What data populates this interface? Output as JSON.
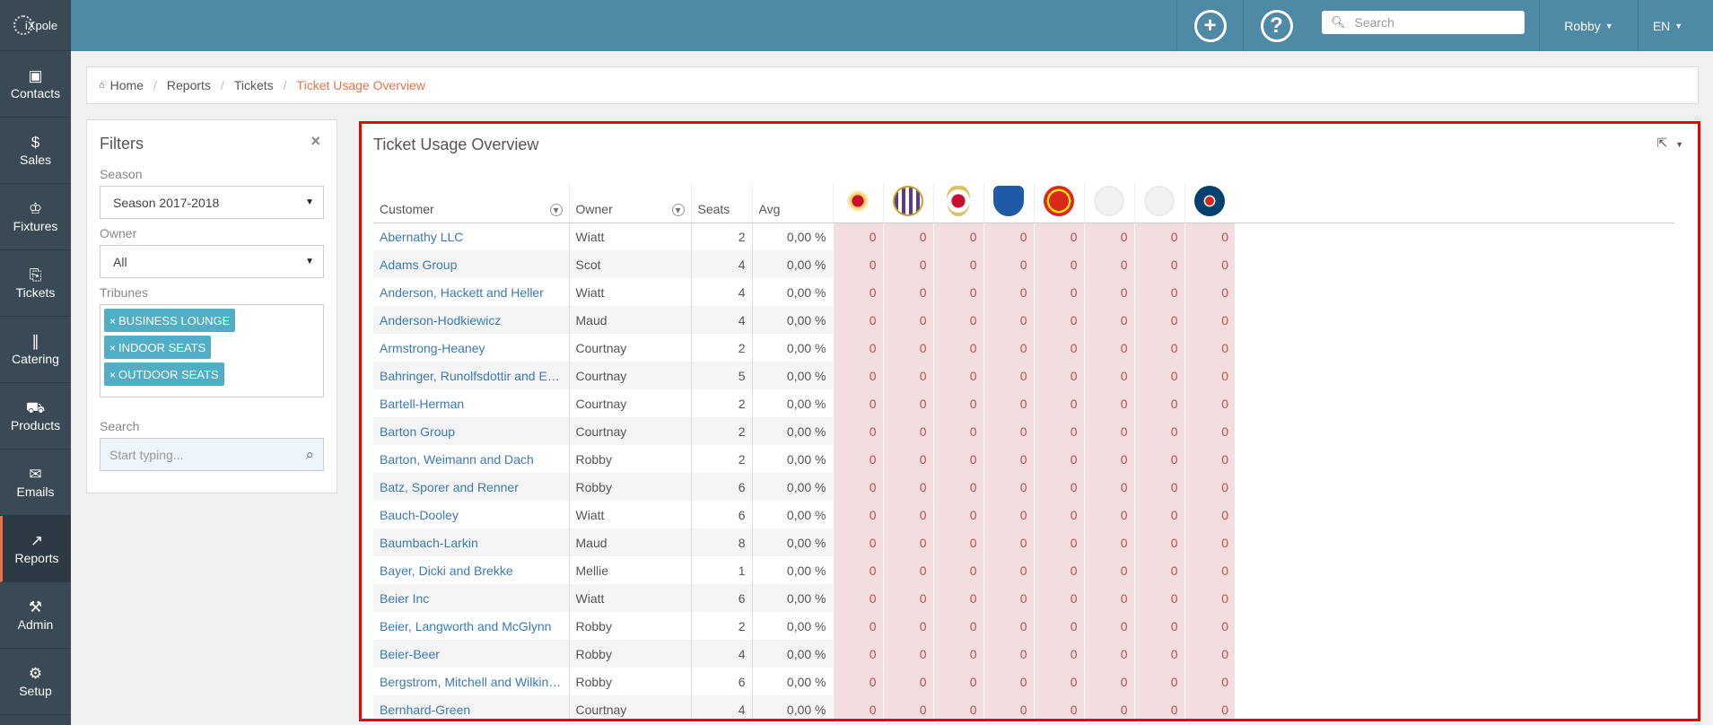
{
  "sidebar": {
    "logo": "iXpole",
    "items": [
      {
        "label": "Contacts",
        "icon": "contact-card-icon"
      },
      {
        "label": "Sales",
        "icon": "dollar-icon"
      },
      {
        "label": "Fixtures",
        "icon": "trophy-icon"
      },
      {
        "label": "Tickets",
        "icon": "ticket-icon"
      },
      {
        "label": "Catering",
        "icon": "cutlery-icon"
      },
      {
        "label": "Products",
        "icon": "cart-icon"
      },
      {
        "label": "Emails",
        "icon": "envelope-icon"
      },
      {
        "label": "Reports",
        "icon": "chart-icon",
        "active": true
      },
      {
        "label": "Admin",
        "icon": "tools-icon"
      },
      {
        "label": "Setup",
        "icon": "gears-icon"
      }
    ]
  },
  "topbar": {
    "add_icon": "+",
    "help_icon": "?",
    "search_placeholder": "Search",
    "user": "Robby",
    "lang": "EN"
  },
  "breadcrumb": {
    "home": "Home",
    "reports": "Reports",
    "tickets": "Tickets",
    "current": "Ticket Usage Overview"
  },
  "filters": {
    "title": "Filters",
    "close": "×",
    "season_label": "Season",
    "season_value": "Season 2017-2018",
    "owner_label": "Owner",
    "owner_value": "All",
    "tribunes_label": "Tribunes",
    "tribunes": [
      "BUSINESS LOUNGE",
      "INDOOR SEATS",
      "OUTDOOR SEATS"
    ],
    "search_label": "Search",
    "search_placeholder": "Start typing..."
  },
  "panel": {
    "title": "Ticket Usage Overview",
    "columns": {
      "customer": "Customer",
      "owner": "Owner",
      "seats": "Seats",
      "avg": "Avg"
    },
    "clubs": [
      "standard-liege-logo",
      "anderlecht-logo",
      "standard-logo-2",
      "genk-logo",
      "manchester-united-logo",
      "placeholder-logo",
      "placeholder-logo",
      "psg-logo"
    ],
    "rows": [
      {
        "customer": "Abernathy LLC",
        "owner": "Wiatt",
        "seats": "2",
        "avg": "0,00 %"
      },
      {
        "customer": "Adams Group",
        "owner": "Scot",
        "seats": "4",
        "avg": "0,00 %"
      },
      {
        "customer": "Anderson, Hackett and Heller",
        "owner": "Wiatt",
        "seats": "4",
        "avg": "0,00 %"
      },
      {
        "customer": "Anderson-Hodkiewicz",
        "owner": "Maud",
        "seats": "4",
        "avg": "0,00 %"
      },
      {
        "customer": "Armstrong-Heaney",
        "owner": "Courtnay",
        "seats": "2",
        "avg": "0,00 %"
      },
      {
        "customer": "Bahringer, Runolfsdottir and Eff...",
        "owner": "Courtnay",
        "seats": "5",
        "avg": "0,00 %"
      },
      {
        "customer": "Bartell-Herman",
        "owner": "Courtnay",
        "seats": "2",
        "avg": "0,00 %"
      },
      {
        "customer": "Barton Group",
        "owner": "Courtnay",
        "seats": "2",
        "avg": "0,00 %"
      },
      {
        "customer": "Barton, Weimann and Dach",
        "owner": "Robby",
        "seats": "2",
        "avg": "0,00 %"
      },
      {
        "customer": "Batz, Sporer and Renner",
        "owner": "Robby",
        "seats": "6",
        "avg": "0,00 %"
      },
      {
        "customer": "Bauch-Dooley",
        "owner": "Wiatt",
        "seats": "6",
        "avg": "0,00 %"
      },
      {
        "customer": "Baumbach-Larkin",
        "owner": "Maud",
        "seats": "8",
        "avg": "0,00 %"
      },
      {
        "customer": "Bayer, Dicki and Brekke",
        "owner": "Mellie",
        "seats": "1",
        "avg": "0,00 %"
      },
      {
        "customer": "Beier Inc",
        "owner": "Wiatt",
        "seats": "6",
        "avg": "0,00 %"
      },
      {
        "customer": "Beier, Langworth and McGlynn",
        "owner": "Robby",
        "seats": "2",
        "avg": "0,00 %"
      },
      {
        "customer": "Beier-Beer",
        "owner": "Robby",
        "seats": "4",
        "avg": "0,00 %"
      },
      {
        "customer": "Bergstrom, Mitchell and Wilkins...",
        "owner": "Robby",
        "seats": "6",
        "avg": "0,00 %"
      },
      {
        "customer": "Bernhard-Green",
        "owner": "Courtnay",
        "seats": "4",
        "avg": "0,00 %"
      }
    ],
    "cell_value": "0"
  }
}
